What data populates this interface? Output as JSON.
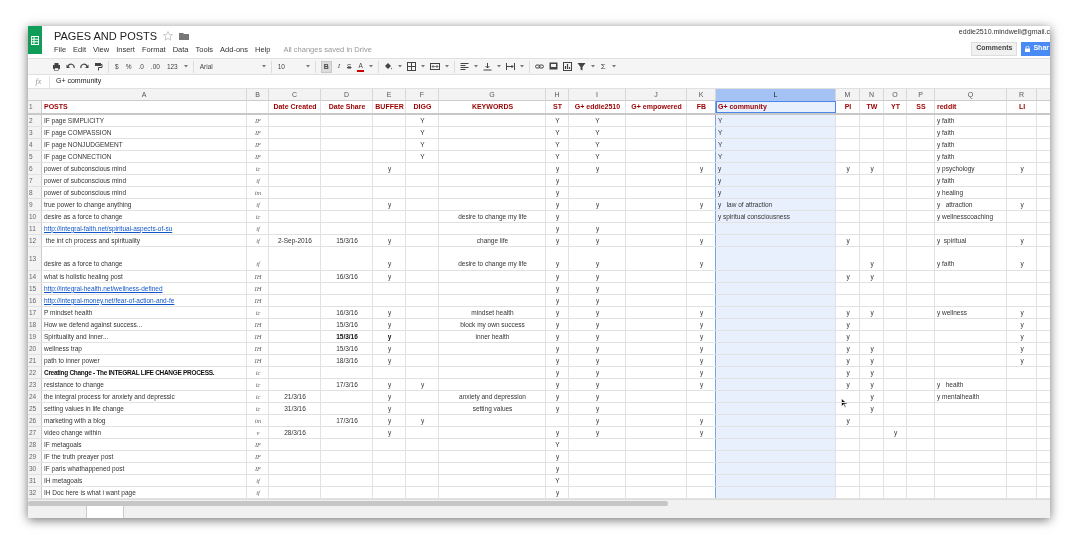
{
  "document": {
    "title": "PAGES AND POSTS",
    "starred": false,
    "save_status": "All changes saved in Drive"
  },
  "menu": [
    "File",
    "Edit",
    "View",
    "Insert",
    "Format",
    "Data",
    "Tools",
    "Add-ons",
    "Help"
  ],
  "account": {
    "email": "eddie2510.mindwell@gmail.c",
    "comments_button": "Comments",
    "share_button": "Shar"
  },
  "toolbar": {
    "currency": "$",
    "percent": "%",
    "decrease_decimals": ".0",
    "increase_decimals": ".00",
    "number_format": "123",
    "font": "Arial",
    "font_size": "10",
    "bold": {
      "label": "B",
      "on": true
    },
    "italic": "I",
    "strikethrough": "S",
    "text_color": "A",
    "functions": "Σ"
  },
  "formula_bar": {
    "label": "fx",
    "value": "G+ community"
  },
  "sheet": {
    "columns": [
      {
        "letter": "A",
        "selected": false
      },
      {
        "letter": "B",
        "selected": false
      },
      {
        "letter": "C",
        "selected": false
      },
      {
        "letter": "D",
        "selected": false
      },
      {
        "letter": "E",
        "selected": false
      },
      {
        "letter": "F",
        "selected": false
      },
      {
        "letter": "G",
        "selected": false
      },
      {
        "letter": "H",
        "selected": false
      },
      {
        "letter": "I",
        "selected": false
      },
      {
        "letter": "J",
        "selected": false
      },
      {
        "letter": "K",
        "selected": false
      },
      {
        "letter": "L",
        "selected": true
      },
      {
        "letter": "M",
        "selected": false
      },
      {
        "letter": "N",
        "selected": false
      },
      {
        "letter": "O",
        "selected": false
      },
      {
        "letter": "P",
        "selected": false
      },
      {
        "letter": "Q",
        "selected": false
      },
      {
        "letter": "R",
        "selected": false
      }
    ],
    "rows": [
      {
        "number": "1",
        "kind": "header",
        "cells": {
          "A": "POSTS",
          "C": "Date Created",
          "D": "Date Share",
          "E": "BUFFER",
          "F": "DIGG",
          "G": "KEYWORDS",
          "H": "ST",
          "I": "G+ eddie2510",
          "J": "G+ empowered",
          "K": "FB",
          "L": {
            "text": "G+ community",
            "selected": true
          },
          "M": "PI",
          "N": "TW",
          "O": "YT",
          "P": "SS",
          "Q": "reddit",
          "R": "LI"
        }
      },
      {
        "number": "2",
        "cells": {
          "A": "IF page SIMPLICITY",
          "B": "IF",
          "F": "Y",
          "H": "Y",
          "I": "Y",
          "L": "Y",
          "Q": "y faith"
        }
      },
      {
        "number": "3",
        "cells": {
          "A": "IF page COMPASSION",
          "B": "IF",
          "F": "Y",
          "H": "Y",
          "I": "Y",
          "L": "Y",
          "Q": "y faith"
        }
      },
      {
        "number": "4",
        "cells": {
          "A": "IF page NONJUDGEMENT",
          "B": "IF",
          "F": "Y",
          "H": "Y",
          "I": "Y",
          "L": "Y",
          "Q": "y faith"
        }
      },
      {
        "number": "5",
        "cells": {
          "A": "IF page CONNECTION",
          "B": "IF",
          "F": "Y",
          "H": "Y",
          "I": "Y",
          "L": "Y",
          "Q": "y faith"
        }
      },
      {
        "number": "6",
        "cells": {
          "A": "power of subconscious mind",
          "B": "ic",
          "E": "y",
          "H": "y",
          "I": "y",
          "K": "y",
          "L": "y",
          "M": "y",
          "N": "y",
          "Q": "y psychology",
          "R": "y"
        }
      },
      {
        "number": "7",
        "cells": {
          "A": "power of subconscious mind",
          "B": "if",
          "H": "y",
          "L": "y",
          "Q": "y faith"
        }
      },
      {
        "number": "8",
        "cells": {
          "A": "power of subconscious mind",
          "B": "im",
          "H": "y",
          "L": "y",
          "Q": "y healing"
        }
      },
      {
        "number": "9",
        "cells": {
          "A": "true power to change anything",
          "B": "if",
          "E": "y",
          "H": "y",
          "I": "y",
          "K": "y",
          "L": "y   law of attraction",
          "Q": "y   attraction",
          "R": "y"
        }
      },
      {
        "number": "10",
        "cells": {
          "A": "desire as a force to change",
          "B": "ic",
          "G": "desire to change my life",
          "H": "y",
          "L": "y spiritual consciousness",
          "Q": "y wellnesscoaching"
        }
      },
      {
        "number": "11",
        "cells": {
          "A": {
            "text": "http://integral-faith.net/spiritual-aspects-of-su",
            "kind": "link"
          },
          "B": "if",
          "H": "y",
          "I": "y"
        }
      },
      {
        "number": "12",
        "cells": {
          "A": " the int ch process and spirituality",
          "B": "if",
          "C": "2-Sep-2016",
          "D": "15/3/16",
          "E": "y",
          "G": "change life",
          "H": "y",
          "I": "y",
          "K": "y",
          "M": "y",
          "Q": "y  spiritual",
          "R": "y"
        }
      },
      {
        "number": "13",
        "tall": true,
        "cells": {
          "A": "desire as a force to change",
          "B": "if",
          "E": "y",
          "G": "desire to change my life",
          "H": "y",
          "I": "y",
          "K": "y",
          "N": "y",
          "Q": "y faith",
          "R": "y"
        }
      },
      {
        "number": "14",
        "cells": {
          "A": "what is holistic healing post",
          "B": "IH",
          "D": "16/3/16",
          "E": "y",
          "H": "y",
          "I": "y",
          "M": "y",
          "N": "y"
        }
      },
      {
        "number": "15",
        "cells": {
          "A": {
            "text": "http://integral-health.net/wellness-defined",
            "kind": "link"
          },
          "B": "IH",
          "H": "y",
          "I": "y"
        }
      },
      {
        "number": "16",
        "cells": {
          "A": {
            "text": "http://integral-money.net/fear-of-action-and-fe",
            "kind": "link"
          },
          "B": "IH",
          "H": "y",
          "I": "y"
        }
      },
      {
        "number": "17",
        "cells": {
          "A": "P mindset health",
          "B": "ic",
          "D": "16/3/16",
          "E": "y",
          "G": "mindset health",
          "H": "y",
          "I": "y",
          "K": "y",
          "M": "y",
          "N": "y",
          "Q": "y wellness",
          "R": "y"
        }
      },
      {
        "number": "18",
        "cells": {
          "A": "How we defend against success...",
          "B": "IH",
          "D": "15/3/16",
          "E": "y",
          "G": "block my own success",
          "H": "y",
          "I": "y",
          "K": "y",
          "M": "y",
          "R": "y"
        }
      },
      {
        "number": "19",
        "cells": {
          "A": "Spirituality and Inner...",
          "B": "IH",
          "D": {
            "text": "15/3/16",
            "kind": "bold"
          },
          "E": {
            "text": "y",
            "kind": "bold"
          },
          "G": "inner health",
          "H": "y",
          "I": "y",
          "K": "y",
          "M": "y",
          "R": "y"
        }
      },
      {
        "number": "20",
        "cells": {
          "A": "wellness trap",
          "B": "IH",
          "D": "15/3/16",
          "E": "y",
          "H": "y",
          "I": "y",
          "K": "y",
          "M": "y",
          "N": "y",
          "R": "y"
        }
      },
      {
        "number": "21",
        "cells": {
          "A": "path to inner power",
          "B": "IH",
          "D": "18/3/16",
          "E": "y",
          "H": "y",
          "I": "y",
          "K": "y",
          "M": "y",
          "N": "y",
          "R": "y"
        }
      },
      {
        "number": "22",
        "cells": {
          "A": {
            "text": "Creating Change - The INTEGRAL LIFE CHANGE PROCESS.",
            "kind": "bold"
          },
          "B": "ic",
          "H": "y",
          "I": "y",
          "K": "y",
          "M": "y",
          "N": "y"
        }
      },
      {
        "number": "23",
        "cells": {
          "A": "resistance to change",
          "B": "ic",
          "D": "17/3/16",
          "E": "y",
          "F": "y",
          "H": "y",
          "I": "y",
          "K": "y",
          "M": "y",
          "N": "y",
          "Q": "y   health"
        }
      },
      {
        "number": "24",
        "cells": {
          "A": "the integral process for anxiety and depressic",
          "B": "ic",
          "C": "21/3/16",
          "E": "y",
          "G": "anxiety and depression",
          "H": "y",
          "I": "y",
          "N": "y",
          "Q": "y mentalhealth"
        }
      },
      {
        "number": "25",
        "cells": {
          "A": "setting values in life change",
          "B": "ic",
          "C": "31/3/16",
          "E": "y",
          "G": "setting values",
          "H": "y",
          "I": "y",
          "N": "y"
        }
      },
      {
        "number": "26",
        "cells": {
          "A": "marketing with a blog",
          "B": "im",
          "D": "17/3/16",
          "E": "y",
          "F": "y",
          "I": "y",
          "K": "y",
          "M": "y"
        }
      },
      {
        "number": "27",
        "cells": {
          "A": "video change within",
          "B": "v",
          "C": "28/3/16",
          "E": "y",
          "H": "y",
          "I": "y",
          "K": "y",
          "O": "y"
        }
      },
      {
        "number": "28",
        "cells": {
          "A": "IF metagoals",
          "B": "IF",
          "H": "Y"
        }
      },
      {
        "number": "29",
        "cells": {
          "A": "IF the truth preayer post",
          "B": "IF",
          "H": "y"
        }
      },
      {
        "number": "30",
        "cells": {
          "A": "IF paris whathappened post",
          "B": "IF",
          "H": "y"
        }
      },
      {
        "number": "31",
        "cells": {
          "A": "IH metagoals",
          "B": "if",
          "H": "Y"
        }
      },
      {
        "number": "32",
        "cells": {
          "A": "IH Doc here is what i want page",
          "B": "if",
          "H": "y"
        }
      }
    ]
  }
}
